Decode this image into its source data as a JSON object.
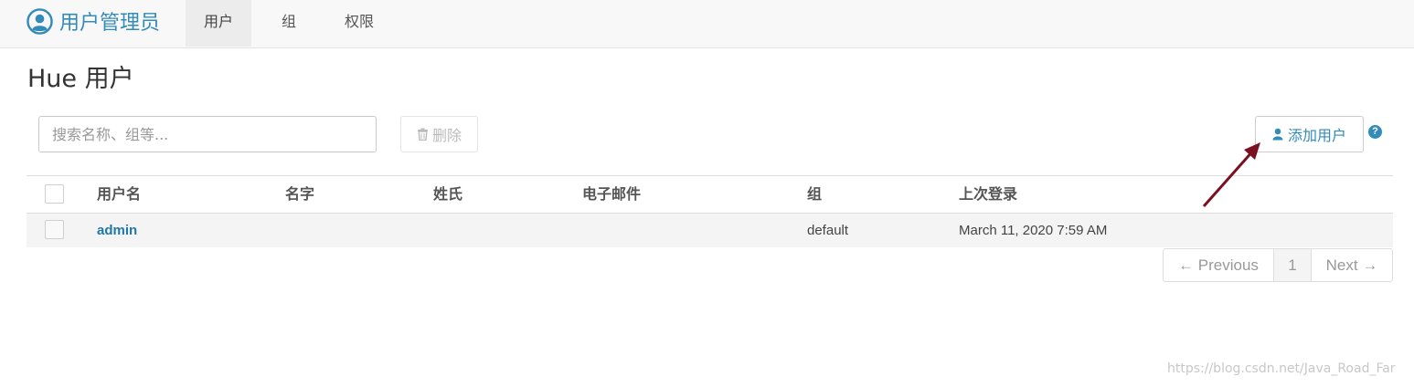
{
  "header": {
    "app_title": "用户管理员",
    "tabs": [
      {
        "label": "用户",
        "active": true
      },
      {
        "label": "组",
        "active": false
      },
      {
        "label": "权限",
        "active": false
      }
    ]
  },
  "page": {
    "title": "Hue 用户"
  },
  "toolbar": {
    "search_placeholder": "搜索名称、组等...",
    "delete_label": "删除",
    "add_user_label": "添加用户",
    "help_glyph": "?"
  },
  "table": {
    "columns": [
      "用户名",
      "名字",
      "姓氏",
      "电子邮件",
      "组",
      "上次登录"
    ],
    "rows": [
      {
        "username": "admin",
        "first_name": "",
        "last_name": "",
        "email": "",
        "group": "default",
        "last_login": "March 11, 2020 7:59 AM"
      }
    ]
  },
  "pagination": {
    "previous": "← Previous",
    "current": "1",
    "next": "Next →"
  },
  "watermark": "https://blog.csdn.net/Java_Road_Far",
  "colors": {
    "accent": "#338bb8",
    "annotation_arrow": "#7a1020"
  }
}
